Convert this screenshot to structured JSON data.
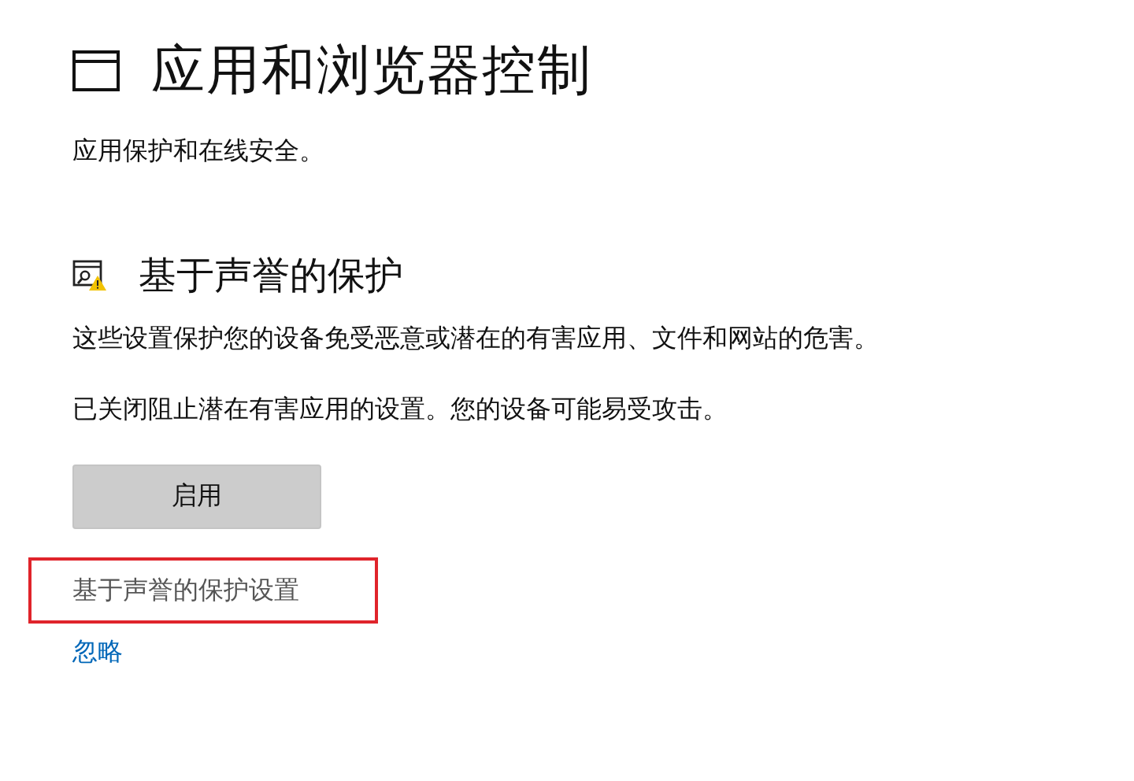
{
  "page": {
    "title": "应用和浏览器控制",
    "subtitle": "应用保护和在线安全。"
  },
  "section": {
    "title": "基于声誉的保护",
    "description": "这些设置保护您的设备免受恶意或潜在的有害应用、文件和网站的危害。",
    "warning": "已关闭阻止潜在有害应用的设置。您的设备可能易受攻击。",
    "button": "启用",
    "links": [
      {
        "label": "基于声誉的保护设置",
        "kind": "settings",
        "highlighted": true
      },
      {
        "label": "忽略",
        "kind": "action",
        "highlighted": false
      }
    ]
  }
}
